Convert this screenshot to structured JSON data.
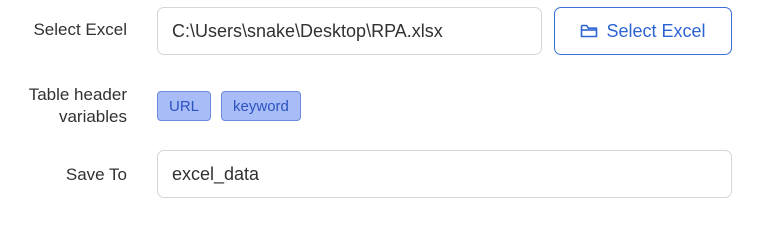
{
  "form": {
    "select_excel": {
      "label": "Select Excel",
      "value": "C:\\Users\\snake\\Desktop\\RPA.xlsx",
      "button_label": "Select Excel",
      "button_icon": "folder-open-icon"
    },
    "header_variables": {
      "label_line1": "Table header",
      "label_line2": "variables",
      "tags": [
        {
          "label": "URL"
        },
        {
          "label": "keyword"
        }
      ]
    },
    "save_to": {
      "label": "Save To",
      "value": "excel_data"
    }
  },
  "colors": {
    "accent": "#2d64d3",
    "tag_bg": "#a8bcf7",
    "border": "#d4d6dc"
  }
}
